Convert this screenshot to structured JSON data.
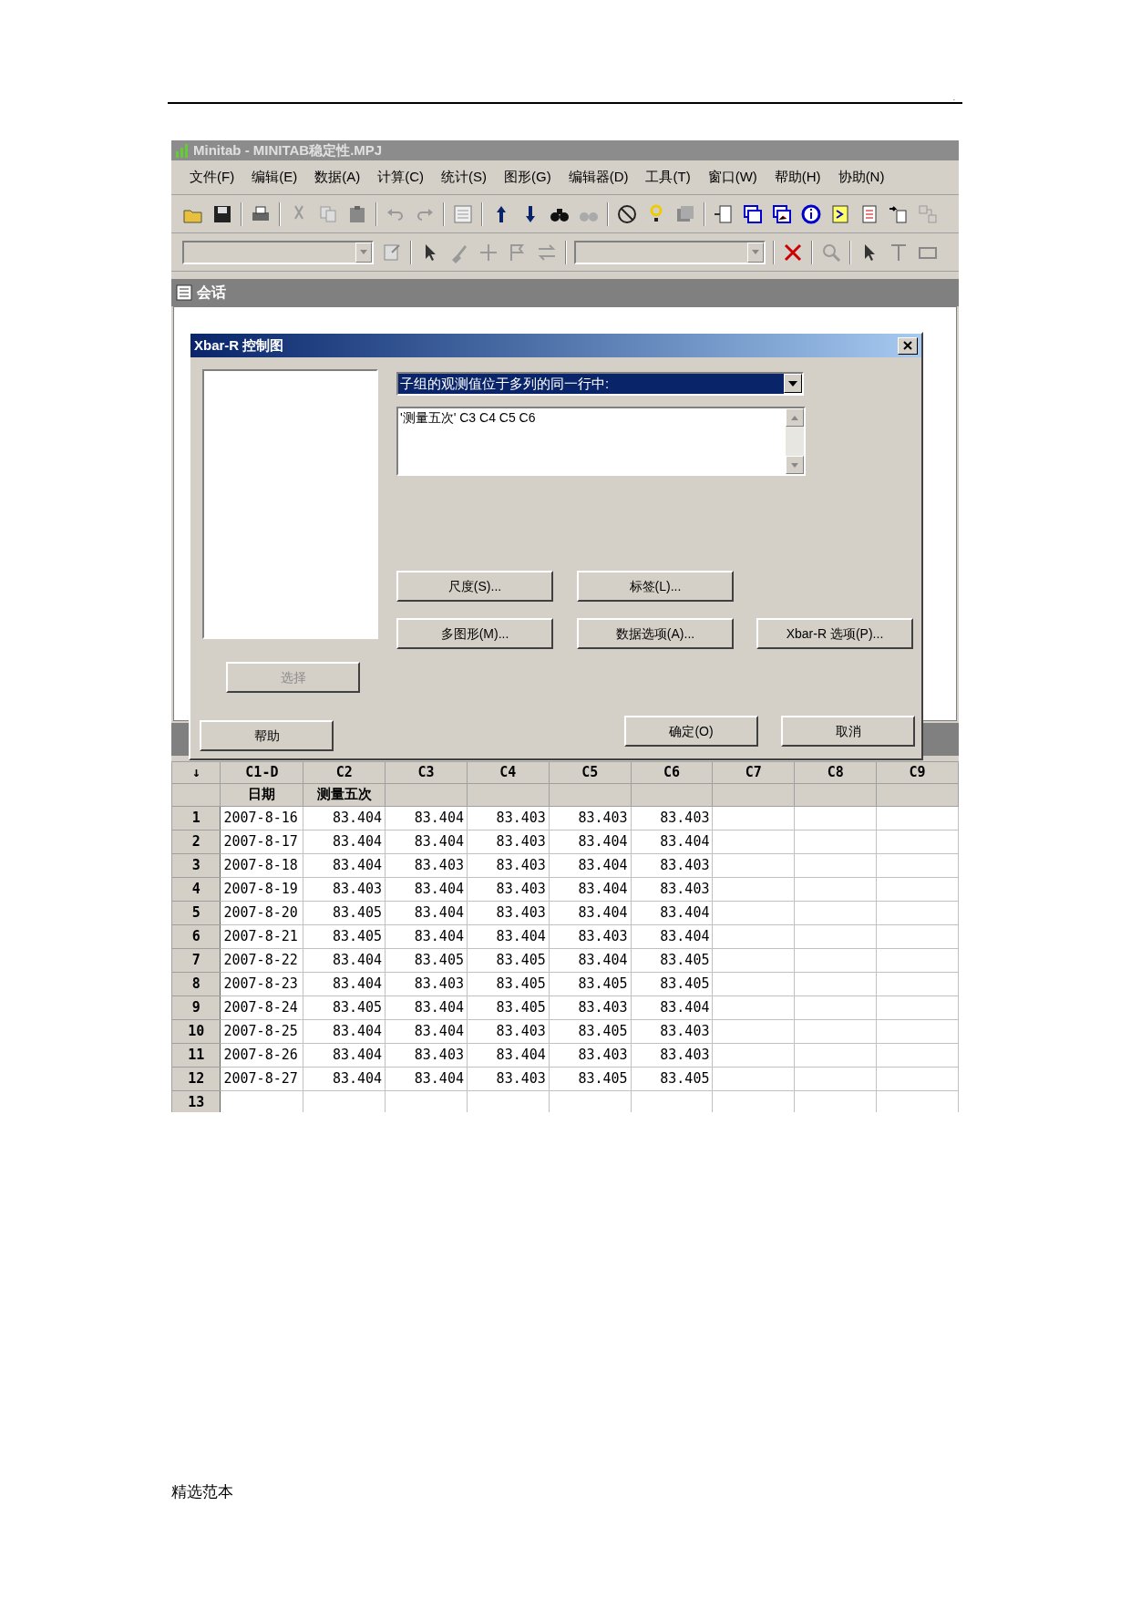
{
  "document": {
    "corner_mark": ".",
    "footer": "精选范本"
  },
  "window": {
    "title": "Minitab - MINITAB稳定性.MPJ"
  },
  "menu": [
    "文件(F)",
    "编辑(E)",
    "数据(A)",
    "计算(C)",
    "统计(S)",
    "图形(G)",
    "编辑器(D)",
    "工具(T)",
    "窗口(W)",
    "帮助(H)",
    "协助(N)"
  ],
  "session": {
    "title": "会话"
  },
  "dialog": {
    "title": "Xbar-R 控制图",
    "dropdown": {
      "value": "子组的观测值位于多列的同一行中:"
    },
    "variables": "'测量五次' C3 C4 C5 C6",
    "buttons": [
      {
        "label": "尺度(S)...",
        "disabled": false
      },
      {
        "label": "标签(L)...",
        "disabled": false
      },
      {
        "label": "多图形(M)...",
        "disabled": false
      },
      {
        "label": "数据选项(A)...",
        "disabled": false
      },
      {
        "label": "Xbar-R 选项(P)...",
        "disabled": false
      },
      {
        "label": "选择",
        "disabled": true
      },
      {
        "label": "帮助",
        "disabled": false
      },
      {
        "label": "确定(O)",
        "disabled": false
      },
      {
        "label": "取消",
        "disabled": false
      }
    ]
  },
  "worksheet": {
    "corner": "↓",
    "columns": [
      {
        "id": "C1-D",
        "name": "日期"
      },
      {
        "id": "C2",
        "name": "测量五次"
      },
      {
        "id": "C3"
      },
      {
        "id": "C4"
      },
      {
        "id": "C5"
      },
      {
        "id": "C6"
      },
      {
        "id": "C7"
      },
      {
        "id": "C8"
      },
      {
        "id": "C9"
      }
    ],
    "rows": [
      {
        "number": "1",
        "cells": [
          "2007-8-16",
          "83.404",
          "83.404",
          "83.403",
          "83.403",
          "83.403"
        ]
      },
      {
        "number": "2",
        "cells": [
          "2007-8-17",
          "83.404",
          "83.404",
          "83.403",
          "83.404",
          "83.404"
        ]
      },
      {
        "number": "3",
        "cells": [
          "2007-8-18",
          "83.404",
          "83.403",
          "83.403",
          "83.404",
          "83.403"
        ]
      },
      {
        "number": "4",
        "cells": [
          "2007-8-19",
          "83.403",
          "83.404",
          "83.403",
          "83.404",
          "83.403"
        ]
      },
      {
        "number": "5",
        "cells": [
          "2007-8-20",
          "83.405",
          "83.404",
          "83.403",
          "83.404",
          "83.404"
        ]
      },
      {
        "number": "6",
        "cells": [
          "2007-8-21",
          "83.405",
          "83.404",
          "83.404",
          "83.403",
          "83.404"
        ]
      },
      {
        "number": "7",
        "cells": [
          "2007-8-22",
          "83.404",
          "83.405",
          "83.405",
          "83.404",
          "83.405"
        ]
      },
      {
        "number": "8",
        "cells": [
          "2007-8-23",
          "83.404",
          "83.403",
          "83.405",
          "83.405",
          "83.405"
        ]
      },
      {
        "number": "9",
        "cells": [
          "2007-8-24",
          "83.405",
          "83.404",
          "83.405",
          "83.403",
          "83.404"
        ]
      },
      {
        "number": "10",
        "cells": [
          "2007-8-25",
          "83.404",
          "83.404",
          "83.403",
          "83.405",
          "83.403"
        ]
      },
      {
        "number": "11",
        "cells": [
          "2007-8-26",
          "83.404",
          "83.403",
          "83.404",
          "83.403",
          "83.403"
        ]
      },
      {
        "number": "12",
        "cells": [
          "2007-8-27",
          "83.404",
          "83.404",
          "83.403",
          "83.405",
          "83.405"
        ]
      },
      {
        "number": "13",
        "cells": []
      }
    ]
  }
}
